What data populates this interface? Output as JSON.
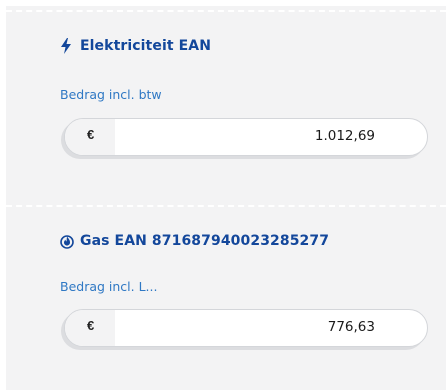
{
  "electricity": {
    "icon": "lightning-bolt-icon",
    "title": "Elektriciteit EAN",
    "amount_label": "Bedrag incl. btw",
    "currency": "€",
    "amount": "1.012,69"
  },
  "gas": {
    "icon": "flame-icon",
    "title": "Gas EAN 871687940023285277",
    "amount_label": "Bedrag incl. L...",
    "currency": "€",
    "amount": "776,63"
  },
  "colors": {
    "title": "#13479b",
    "label": "#2f78c4",
    "panel": "#f3f3f4"
  }
}
